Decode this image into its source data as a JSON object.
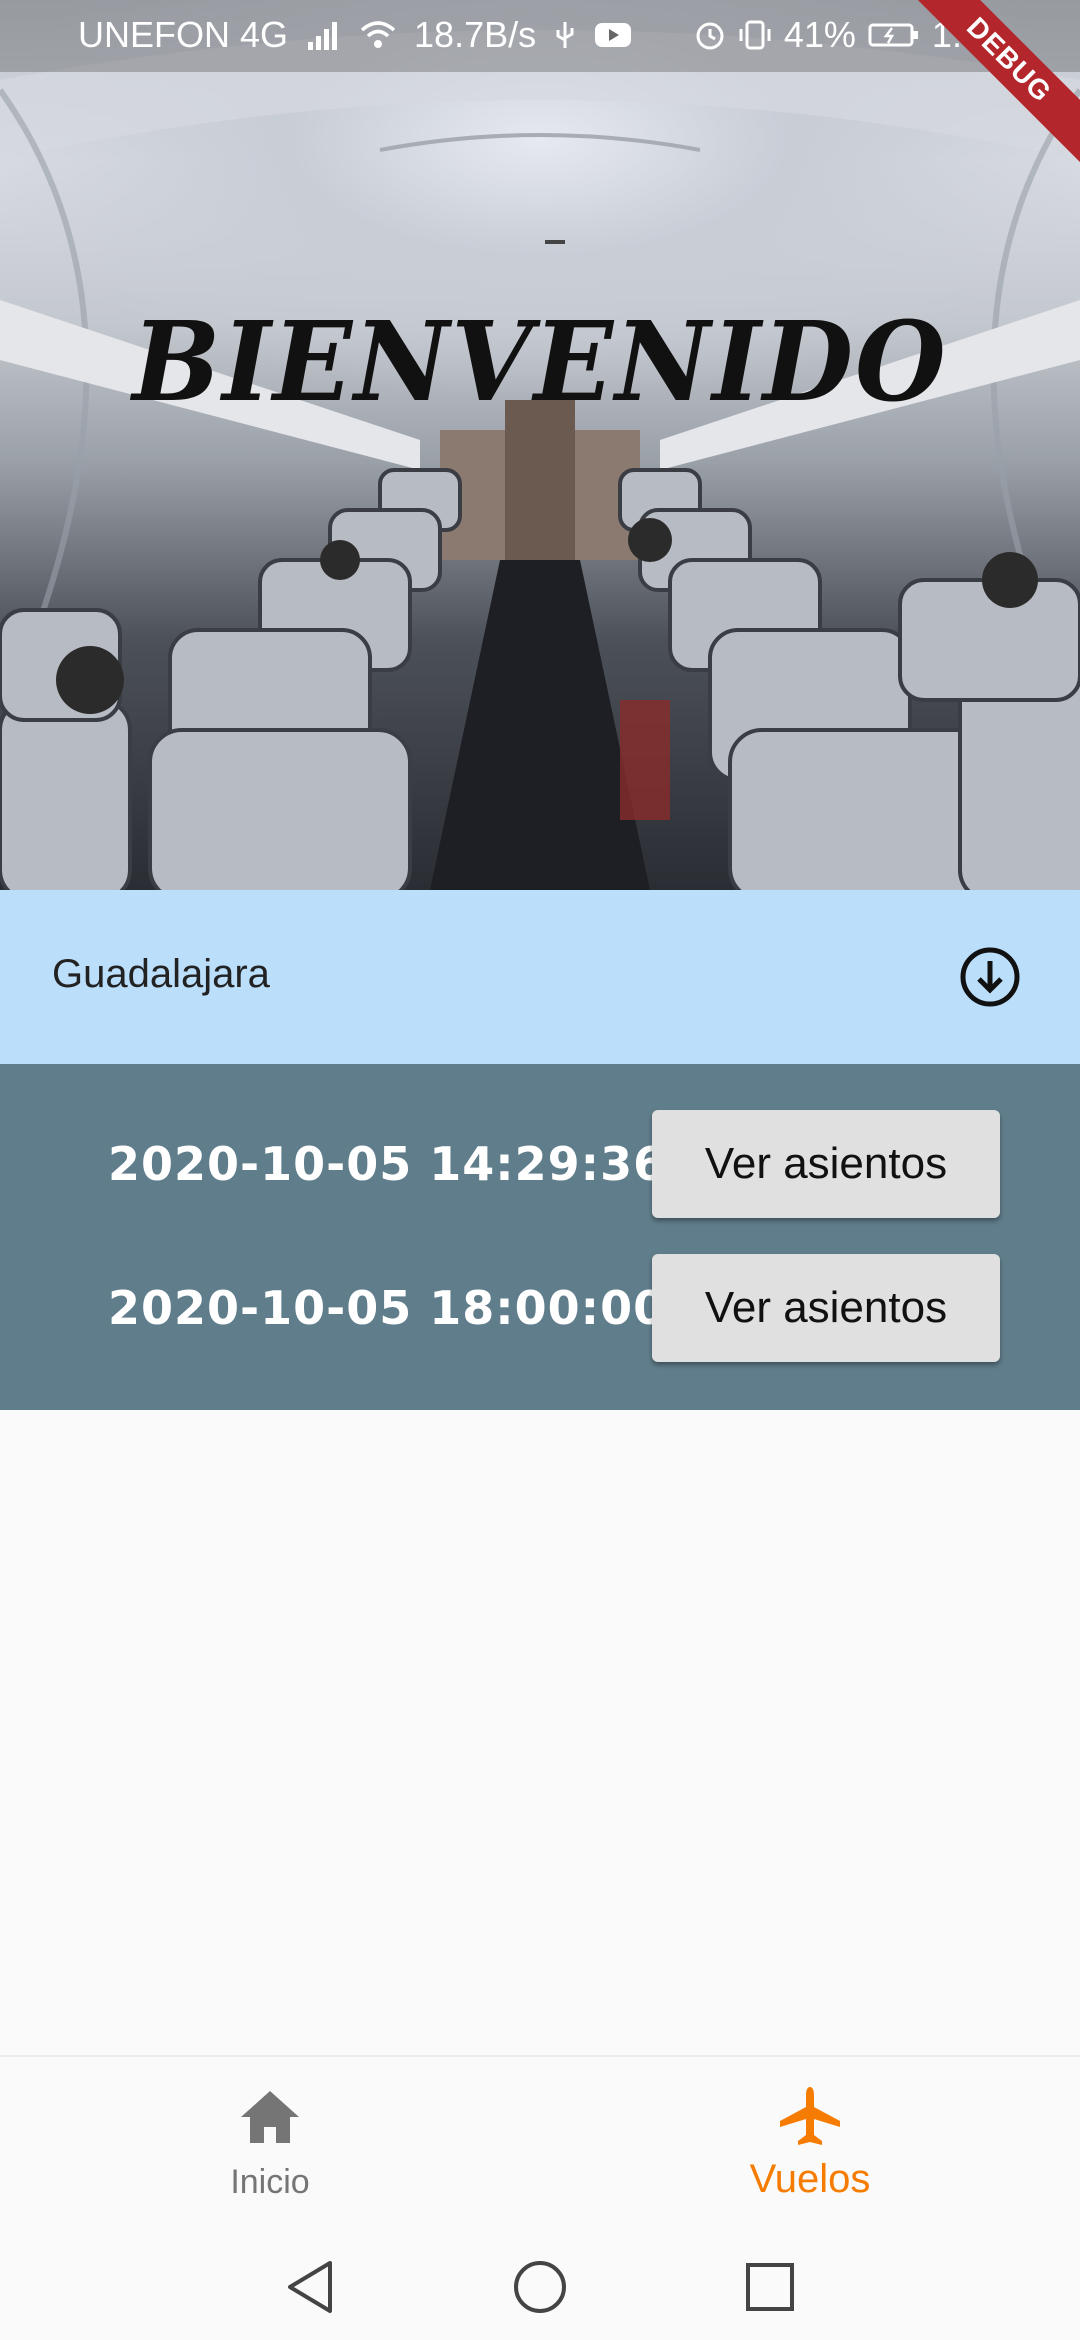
{
  "status_bar": {
    "carrier": "UNEFON 4G",
    "net_speed": "18.7B/s",
    "battery": "41%",
    "time": "1:15"
  },
  "debug_banner": "DEBUG",
  "hero": {
    "title": "BIENVENIDO"
  },
  "city": {
    "name": "Guadalajara",
    "expand_icon": "arrow-circle-down-icon"
  },
  "flights": [
    {
      "datetime": "2020-10-05  14:29:36",
      "button_label": "Ver asientos"
    },
    {
      "datetime": "2020-10-05  18:00:00",
      "button_label": "Ver asientos"
    }
  ],
  "bottom_nav": {
    "items": [
      {
        "label": "Inicio",
        "icon": "home-icon",
        "active": false
      },
      {
        "label": "Vuelos",
        "icon": "airplane-icon",
        "active": true
      }
    ]
  },
  "colors": {
    "active": "#f57c00",
    "inactive": "#757575",
    "city_header_bg": "#bbdefb",
    "flights_bg": "#607d8b",
    "button_bg": "#e0e0e0"
  }
}
